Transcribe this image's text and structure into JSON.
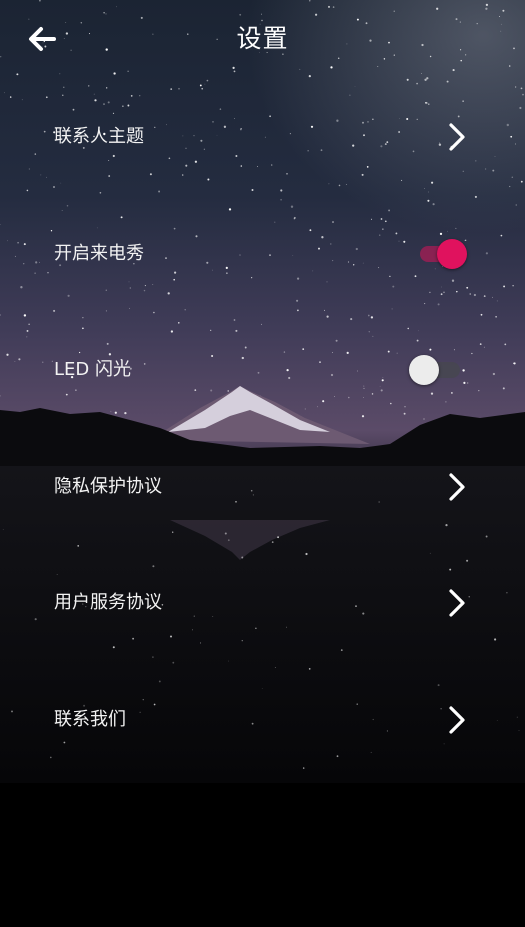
{
  "header": {
    "title": "设置",
    "back_icon": "arrow-left-icon"
  },
  "settings": {
    "contact_theme": {
      "label": "联系人主题",
      "icon": "chevron-right-icon"
    },
    "caller_show": {
      "label": "开启来电秀",
      "enabled": true
    },
    "led_flash": {
      "label": "LED 闪光",
      "enabled": false
    },
    "privacy_policy": {
      "label": "隐私保护协议",
      "icon": "chevron-right-icon"
    },
    "user_agreement": {
      "label": "用户服务协议",
      "icon": "chevron-right-icon"
    },
    "contact_us": {
      "label": "联系我们",
      "icon": "chevron-right-icon"
    }
  },
  "colors": {
    "toggle_on": "#e0125e",
    "toggle_off_knob": "#ececec",
    "text": "#ffffff"
  }
}
